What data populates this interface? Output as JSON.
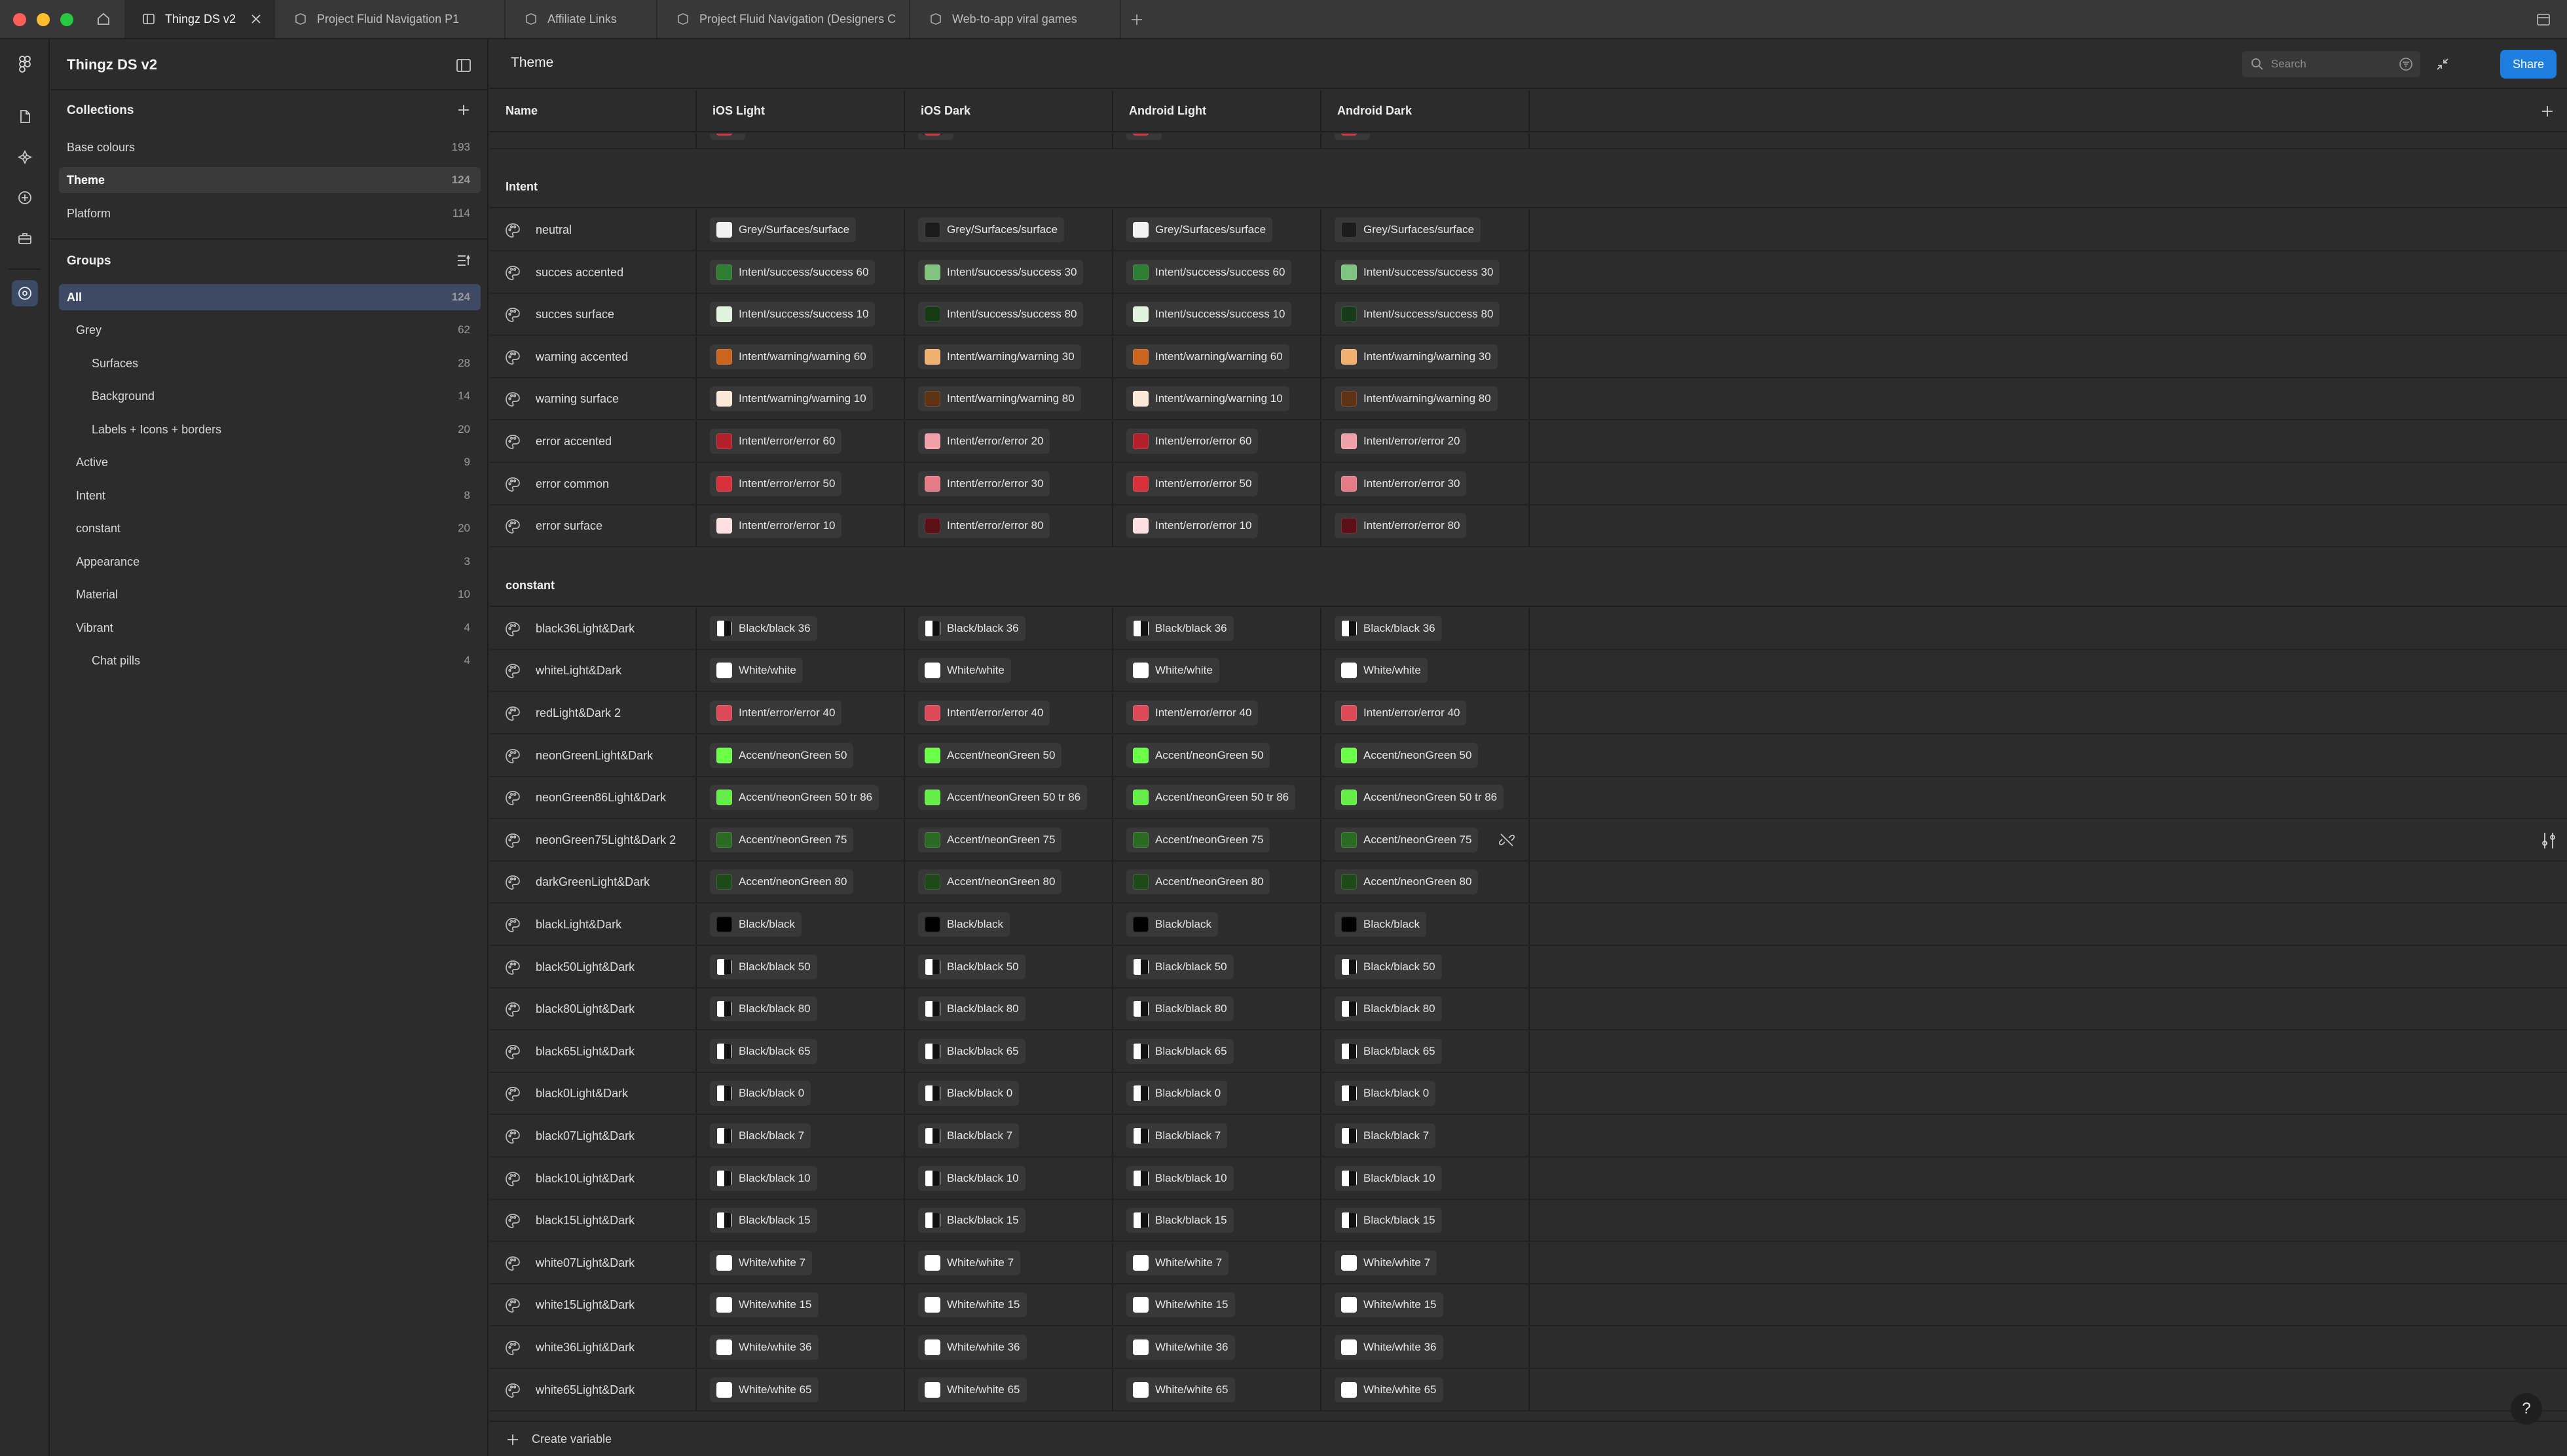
{
  "tabs": [
    {
      "label": "Thingz DS v2",
      "active": true
    },
    {
      "label": "Project Fluid Navigation P1",
      "active": false
    },
    {
      "label": "Affiliate Links",
      "active": false
    },
    {
      "label": "Project Fluid Navigation (Designers C",
      "active": false
    },
    {
      "label": "Web-to-app viral games",
      "active": false
    }
  ],
  "sidebar": {
    "title": "Thingz DS v2",
    "collections_heading": "Collections",
    "collections": [
      {
        "label": "Base colours",
        "count": "193"
      },
      {
        "label": "Theme",
        "count": "124"
      },
      {
        "label": "Platform",
        "count": "114"
      }
    ],
    "groups_heading": "Groups",
    "groups": [
      {
        "label": "All",
        "count": "124"
      },
      {
        "label": "Grey",
        "count": "62"
      },
      {
        "label": "Surfaces",
        "count": "28"
      },
      {
        "label": "Background",
        "count": "14"
      },
      {
        "label": "Labels + Icons + borders",
        "count": "20"
      },
      {
        "label": "Active",
        "count": "9"
      },
      {
        "label": "Intent",
        "count": "8"
      },
      {
        "label": "constant",
        "count": "20"
      },
      {
        "label": "Appearance",
        "count": "3"
      },
      {
        "label": "Material",
        "count": "10"
      },
      {
        "label": "Vibrant",
        "count": "4"
      },
      {
        "label": "Chat pills",
        "count": "4"
      }
    ]
  },
  "main": {
    "title": "Theme",
    "search_placeholder": "Search",
    "share_label": "Share",
    "columns": [
      "Name",
      "iOS Light",
      "iOS Dark",
      "Android Light",
      "Android Dark"
    ],
    "create_variable_label": "Create variable",
    "help_label": "?"
  },
  "groups_table": [
    {
      "name": "Intent",
      "rows": [
        {
          "name": "neutral",
          "values": [
            [
              "Grey/Surfaces/surface",
              "#f2f2f2"
            ],
            [
              "Grey/Surfaces/surface",
              "#1c1c1c"
            ],
            [
              "Grey/Surfaces/surface",
              "#f2f2f2"
            ],
            [
              "Grey/Surfaces/surface",
              "#1c1c1c"
            ]
          ]
        },
        {
          "name": "succes accented",
          "values": [
            [
              "Intent/success/success 60",
              "#2f7d32"
            ],
            [
              "Intent/success/success 30",
              "#7fc47f"
            ],
            [
              "Intent/success/success 60",
              "#2f7d32"
            ],
            [
              "Intent/success/success 30",
              "#7fc47f"
            ]
          ]
        },
        {
          "name": "succes surface",
          "values": [
            [
              "Intent/success/success 10",
              "#dff3df"
            ],
            [
              "Intent/success/success 80",
              "#173a18"
            ],
            [
              "Intent/success/success 10",
              "#dff3df"
            ],
            [
              "Intent/success/success 80",
              "#173a18"
            ]
          ]
        },
        {
          "name": "warning accented",
          "values": [
            [
              "Intent/warning/warning 60",
              "#c9651d"
            ],
            [
              "Intent/warning/warning 30",
              "#f0b070"
            ],
            [
              "Intent/warning/warning 60",
              "#c9651d"
            ],
            [
              "Intent/warning/warning 30",
              "#f0b070"
            ]
          ]
        },
        {
          "name": "warning surface",
          "values": [
            [
              "Intent/warning/warning 10",
              "#fbe9d8"
            ],
            [
              "Intent/warning/warning 80",
              "#5e3214"
            ],
            [
              "Intent/warning/warning 10",
              "#fbe9d8"
            ],
            [
              "Intent/warning/warning 80",
              "#5e3214"
            ]
          ]
        },
        {
          "name": "error accented",
          "values": [
            [
              "Intent/error/error 60",
              "#b3202a"
            ],
            [
              "Intent/error/error 20",
              "#f0a0a8"
            ],
            [
              "Intent/error/error 60",
              "#b3202a"
            ],
            [
              "Intent/error/error 20",
              "#f0a0a8"
            ]
          ]
        },
        {
          "name": "error common",
          "values": [
            [
              "Intent/error/error 50",
              "#d6303a"
            ],
            [
              "Intent/error/error 30",
              "#e47c86"
            ],
            [
              "Intent/error/error 50",
              "#d6303a"
            ],
            [
              "Intent/error/error 30",
              "#e47c86"
            ]
          ]
        },
        {
          "name": "error surface",
          "values": [
            [
              "Intent/error/error 10",
              "#fde0e2"
            ],
            [
              "Intent/error/error 80",
              "#5a1016"
            ],
            [
              "Intent/error/error 10",
              "#fde0e2"
            ],
            [
              "Intent/error/error 80",
              "#5a1016"
            ]
          ]
        }
      ]
    },
    {
      "name": "constant",
      "rows": [
        {
          "name": "black36Light&Dark",
          "values": [
            [
              "Black/black 36",
              "split"
            ],
            [
              "Black/black 36",
              "split"
            ],
            [
              "Black/black 36",
              "split"
            ],
            [
              "Black/black 36",
              "split"
            ]
          ]
        },
        {
          "name": "whiteLight&Dark",
          "values": [
            [
              "White/white",
              "#ffffff"
            ],
            [
              "White/white",
              "#ffffff"
            ],
            [
              "White/white",
              "#ffffff"
            ],
            [
              "White/white",
              "#ffffff"
            ]
          ]
        },
        {
          "name": "redLight&Dark 2",
          "values": [
            [
              "Intent/error/error 40",
              "#dc4a58"
            ],
            [
              "Intent/error/error 40",
              "#dc4a58"
            ],
            [
              "Intent/error/error 40",
              "#dc4a58"
            ],
            [
              "Intent/error/error 40",
              "#dc4a58"
            ]
          ]
        },
        {
          "name": "neonGreenLight&Dark",
          "values": [
            [
              "Accent/neonGreen 50",
              "#6cff4a"
            ],
            [
              "Accent/neonGreen 50",
              "#6cff4a"
            ],
            [
              "Accent/neonGreen 50",
              "#6cff4a"
            ],
            [
              "Accent/neonGreen 50",
              "#6cff4a"
            ]
          ]
        },
        {
          "name": "neonGreen86Light&Dark",
          "values": [
            [
              "Accent/neonGreen 50 tr 86",
              "#66ee48"
            ],
            [
              "Accent/neonGreen 50 tr 86",
              "#66ee48"
            ],
            [
              "Accent/neonGreen 50 tr 86",
              "#66ee48"
            ],
            [
              "Accent/neonGreen 50 tr 86",
              "#66ee48"
            ]
          ]
        },
        {
          "name": "neonGreen75Light&Dark 2",
          "values": [
            [
              "Accent/neonGreen 75",
              "#2a6a22"
            ],
            [
              "Accent/neonGreen 75",
              "#2a6a22"
            ],
            [
              "Accent/neonGreen 75",
              "#2a6a22"
            ],
            [
              "Accent/neonGreen 75",
              "#2a6a22"
            ]
          ]
        },
        {
          "name": "darkGreenLight&Dark",
          "values": [
            [
              "Accent/neonGreen 80",
              "#1d4a18"
            ],
            [
              "Accent/neonGreen 80",
              "#1d4a18"
            ],
            [
              "Accent/neonGreen 80",
              "#1d4a18"
            ],
            [
              "Accent/neonGreen 80",
              "#1d4a18"
            ]
          ]
        },
        {
          "name": "blackLight&Dark",
          "values": [
            [
              "Black/black",
              "#000000"
            ],
            [
              "Black/black",
              "#000000"
            ],
            [
              "Black/black",
              "#000000"
            ],
            [
              "Black/black",
              "#000000"
            ]
          ]
        },
        {
          "name": "black50Light&Dark",
          "values": [
            [
              "Black/black 50",
              "split"
            ],
            [
              "Black/black 50",
              "split"
            ],
            [
              "Black/black 50",
              "split"
            ],
            [
              "Black/black 50",
              "split"
            ]
          ]
        },
        {
          "name": "black80Light&Dark",
          "values": [
            [
              "Black/black 80",
              "split"
            ],
            [
              "Black/black 80",
              "split"
            ],
            [
              "Black/black 80",
              "split"
            ],
            [
              "Black/black 80",
              "split"
            ]
          ]
        },
        {
          "name": "black65Light&Dark",
          "values": [
            [
              "Black/black 65",
              "split"
            ],
            [
              "Black/black 65",
              "split"
            ],
            [
              "Black/black 65",
              "split"
            ],
            [
              "Black/black 65",
              "split"
            ]
          ]
        },
        {
          "name": "black0Light&Dark",
          "values": [
            [
              "Black/black 0",
              "split"
            ],
            [
              "Black/black 0",
              "split"
            ],
            [
              "Black/black 0",
              "split"
            ],
            [
              "Black/black 0",
              "split"
            ]
          ]
        },
        {
          "name": "black07Light&Dark",
          "values": [
            [
              "Black/black 7",
              "split"
            ],
            [
              "Black/black 7",
              "split"
            ],
            [
              "Black/black 7",
              "split"
            ],
            [
              "Black/black 7",
              "split"
            ]
          ]
        },
        {
          "name": "black10Light&Dark",
          "values": [
            [
              "Black/black 10",
              "split"
            ],
            [
              "Black/black 10",
              "split"
            ],
            [
              "Black/black 10",
              "split"
            ],
            [
              "Black/black 10",
              "split"
            ]
          ]
        },
        {
          "name": "black15Light&Dark",
          "values": [
            [
              "Black/black 15",
              "split"
            ],
            [
              "Black/black 15",
              "split"
            ],
            [
              "Black/black 15",
              "split"
            ],
            [
              "Black/black 15",
              "split"
            ]
          ]
        },
        {
          "name": "white07Light&Dark",
          "values": [
            [
              "White/white 7",
              "#ffffff"
            ],
            [
              "White/white 7",
              "#ffffff"
            ],
            [
              "White/white 7",
              "#ffffff"
            ],
            [
              "White/white 7",
              "#ffffff"
            ]
          ]
        },
        {
          "name": "white15Light&Dark",
          "values": [
            [
              "White/white 15",
              "#ffffff"
            ],
            [
              "White/white 15",
              "#ffffff"
            ],
            [
              "White/white 15",
              "#ffffff"
            ],
            [
              "White/white 15",
              "#ffffff"
            ]
          ]
        },
        {
          "name": "white36Light&Dark",
          "values": [
            [
              "White/white 36",
              "#ffffff"
            ],
            [
              "White/white 36",
              "#ffffff"
            ],
            [
              "White/white 36",
              "#ffffff"
            ],
            [
              "White/white 36",
              "#ffffff"
            ]
          ]
        },
        {
          "name": "white65Light&Dark",
          "values": [
            [
              "White/white 65",
              "#ffffff"
            ],
            [
              "White/white 65",
              "#ffffff"
            ],
            [
              "White/white 65",
              "#ffffff"
            ],
            [
              "White/white 65",
              "#ffffff"
            ]
          ]
        }
      ]
    }
  ]
}
